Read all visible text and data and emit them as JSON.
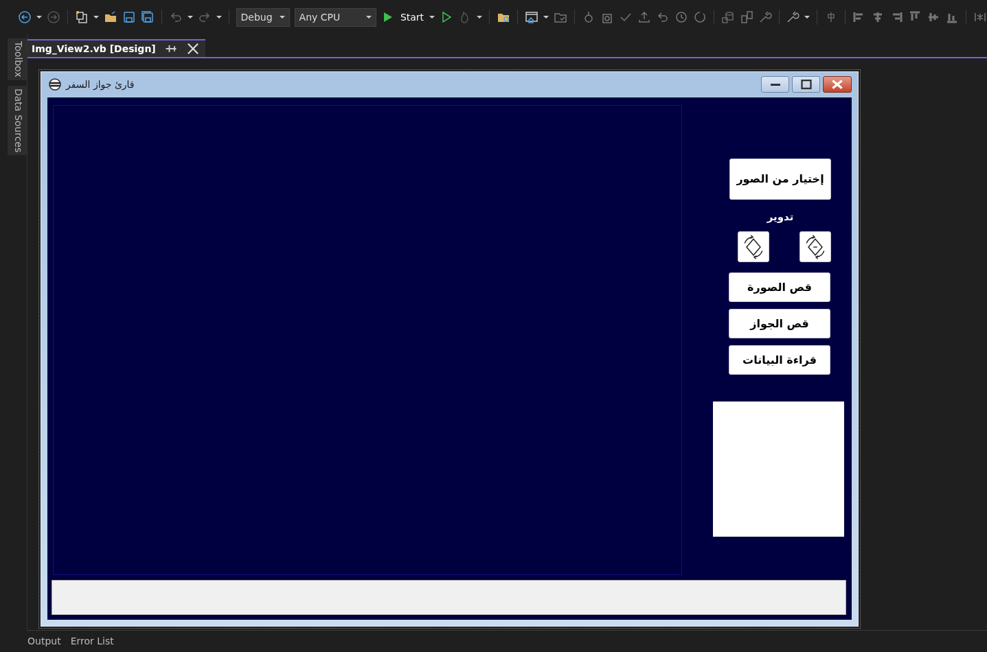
{
  "toolbar": {
    "configuration": "Debug",
    "platform": "Any CPU",
    "start_label": "Start"
  },
  "side_tabs": [
    "Toolbox",
    "Data Sources"
  ],
  "document_tab": {
    "title": "Img_View2.vb [Design]",
    "selected": true
  },
  "form": {
    "title": "قارئ جواز السفر",
    "choose_button": "إختيار من الصور",
    "rotate_label": "تدوير",
    "action_buttons": [
      "قص الصورة",
      "قص الجواز",
      "قراءة البيانات"
    ]
  },
  "bottom_panel": {
    "output_tab": "Output",
    "error_list_tab": "Error List"
  }
}
